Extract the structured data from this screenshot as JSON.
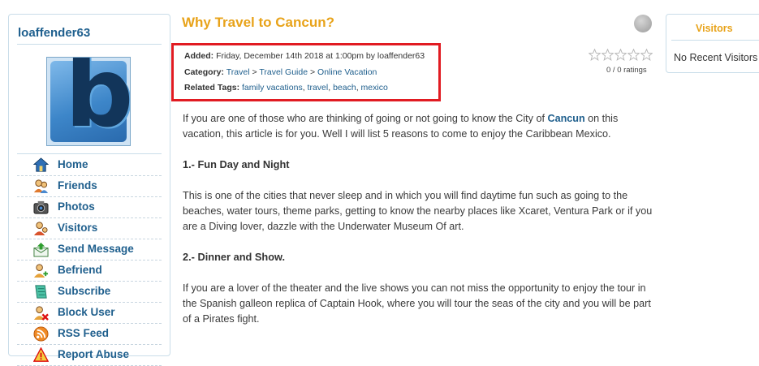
{
  "profile": {
    "username": "loaffender63",
    "avatar_letter": "b"
  },
  "nav": {
    "items": [
      {
        "label": "Home",
        "icon": "home-icon"
      },
      {
        "label": "Friends",
        "icon": "friends-icon"
      },
      {
        "label": "Photos",
        "icon": "camera-icon"
      },
      {
        "label": "Visitors",
        "icon": "visitors-icon"
      },
      {
        "label": "Send Message",
        "icon": "send-message-icon"
      },
      {
        "label": "Befriend",
        "icon": "add-friend-icon"
      },
      {
        "label": "Subscribe",
        "icon": "subscribe-icon"
      },
      {
        "label": "Block User",
        "icon": "block-user-icon"
      },
      {
        "label": "RSS Feed",
        "icon": "rss-icon"
      },
      {
        "label": "Report Abuse",
        "icon": "warning-icon"
      }
    ]
  },
  "article": {
    "title": "Why Travel to Cancun?",
    "added_label": "Added:",
    "added_value": "Friday, December 14th 2018 at 1:00pm by loaffender63",
    "category_label": "Category:",
    "category_path": [
      "Travel",
      "Travel Guide",
      "Online Vacation"
    ],
    "category_sep": ">",
    "tags_label": "Related Tags:",
    "tags": [
      "family vacations",
      "travel",
      "beach",
      "mexico"
    ],
    "tags_sep": ",",
    "rating_text": "0 / 0 ratings",
    "star_count": 5,
    "intro_before": "If you are one of those who are thinking of going or not going to know the City of",
    "intro_link": "Cancun",
    "intro_after": "on this vacation, this article is for you. Well I will list 5 reasons to come to enjoy the Caribbean Mexico.",
    "heading1": "1.- Fun Day and Night",
    "para1": "This is one of the cities that never sleep and in which you will find daytime fun such as going to the beaches, water tours, theme parks, getting to know the nearby places like Xcaret, Ventura Park or if you are a Diving lover, dazzle with the Underwater Museum Of art.",
    "heading2": "2.- Dinner and Show.",
    "para2": "If you are a lover of the theater and the live shows you can not miss the opportunity to enjoy the tour in the Spanish galleon replica of Captain Hook, where you will tour the seas of the city and you will be part of a Pirates fight."
  },
  "visitors": {
    "title": "Visitors",
    "empty_text": "No Recent Visitors"
  },
  "colors": {
    "accent": "#e8a31a",
    "link": "#1f5f8d",
    "highlight_border": "#e11b22"
  }
}
